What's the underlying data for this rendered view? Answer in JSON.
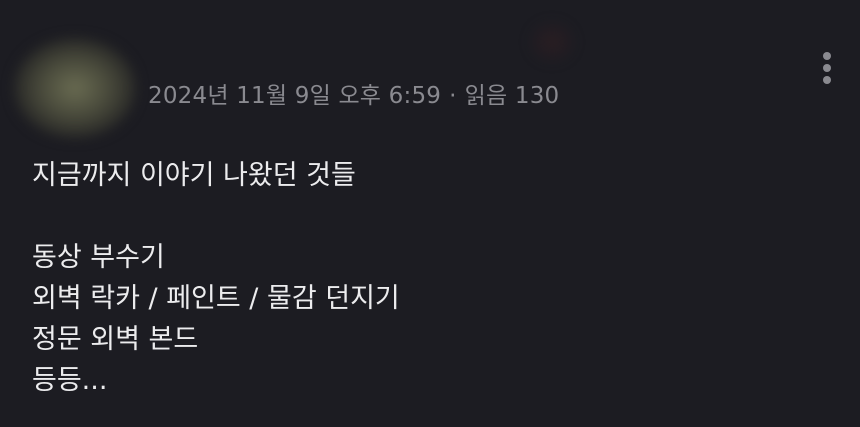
{
  "post": {
    "timestamp": "2024년 11월 9일 오후 6:59",
    "separator": "·",
    "views": "읽음 130",
    "menu_icon": "more-vertical-icon",
    "lines": [
      "지금까지 이야기 나왔던 것들",
      "",
      "동상 부수기",
      "외벽 락카 / 페인트 / 물감 던지기",
      "정문 외벽 본드",
      "등등..."
    ]
  },
  "colors": {
    "background": "#1c1c22",
    "text": "#ececee",
    "meta_text": "#8a8a90"
  }
}
